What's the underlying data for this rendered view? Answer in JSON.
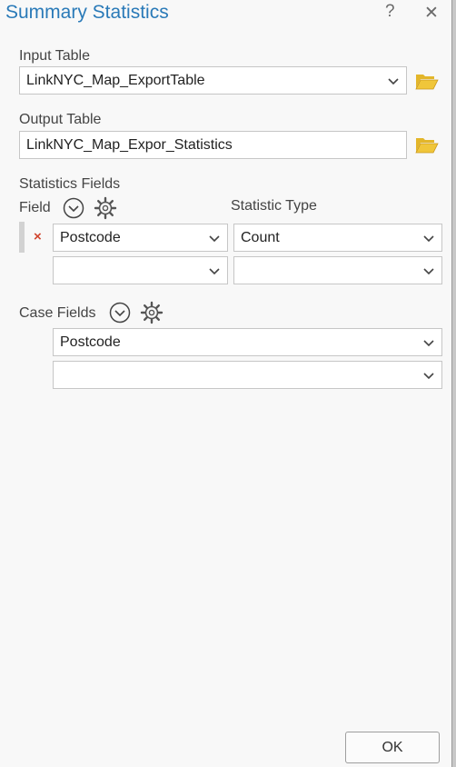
{
  "dialog": {
    "title": "Summary Statistics",
    "help_label": "?",
    "close_label": "✕"
  },
  "input_table": {
    "label": "Input Table",
    "value": "LinkNYC_Map_ExportTable"
  },
  "output_table": {
    "label": "Output Table",
    "value": "LinkNYC_Map_Expor_Statistics"
  },
  "statistics_fields": {
    "section_label": "Statistics Fields",
    "field_label": "Field",
    "statistic_type_label": "Statistic Type",
    "rows": [
      {
        "field": "Postcode",
        "statistic_type": "Count"
      },
      {
        "field": "",
        "statistic_type": ""
      }
    ],
    "remove_label": "×"
  },
  "case_fields": {
    "label": "Case Fields",
    "rows": [
      {
        "value": "Postcode"
      },
      {
        "value": ""
      }
    ]
  },
  "footer": {
    "ok_label": "OK"
  },
  "icons": {
    "browse": "folder-open-icon",
    "expand": "chevron-circle-down-icon",
    "options": "gear-icon",
    "dropdown": "chevron-down-icon"
  },
  "colors": {
    "title": "#2a7ab8",
    "folder": "#e3b62a",
    "remove": "#d0452e"
  }
}
